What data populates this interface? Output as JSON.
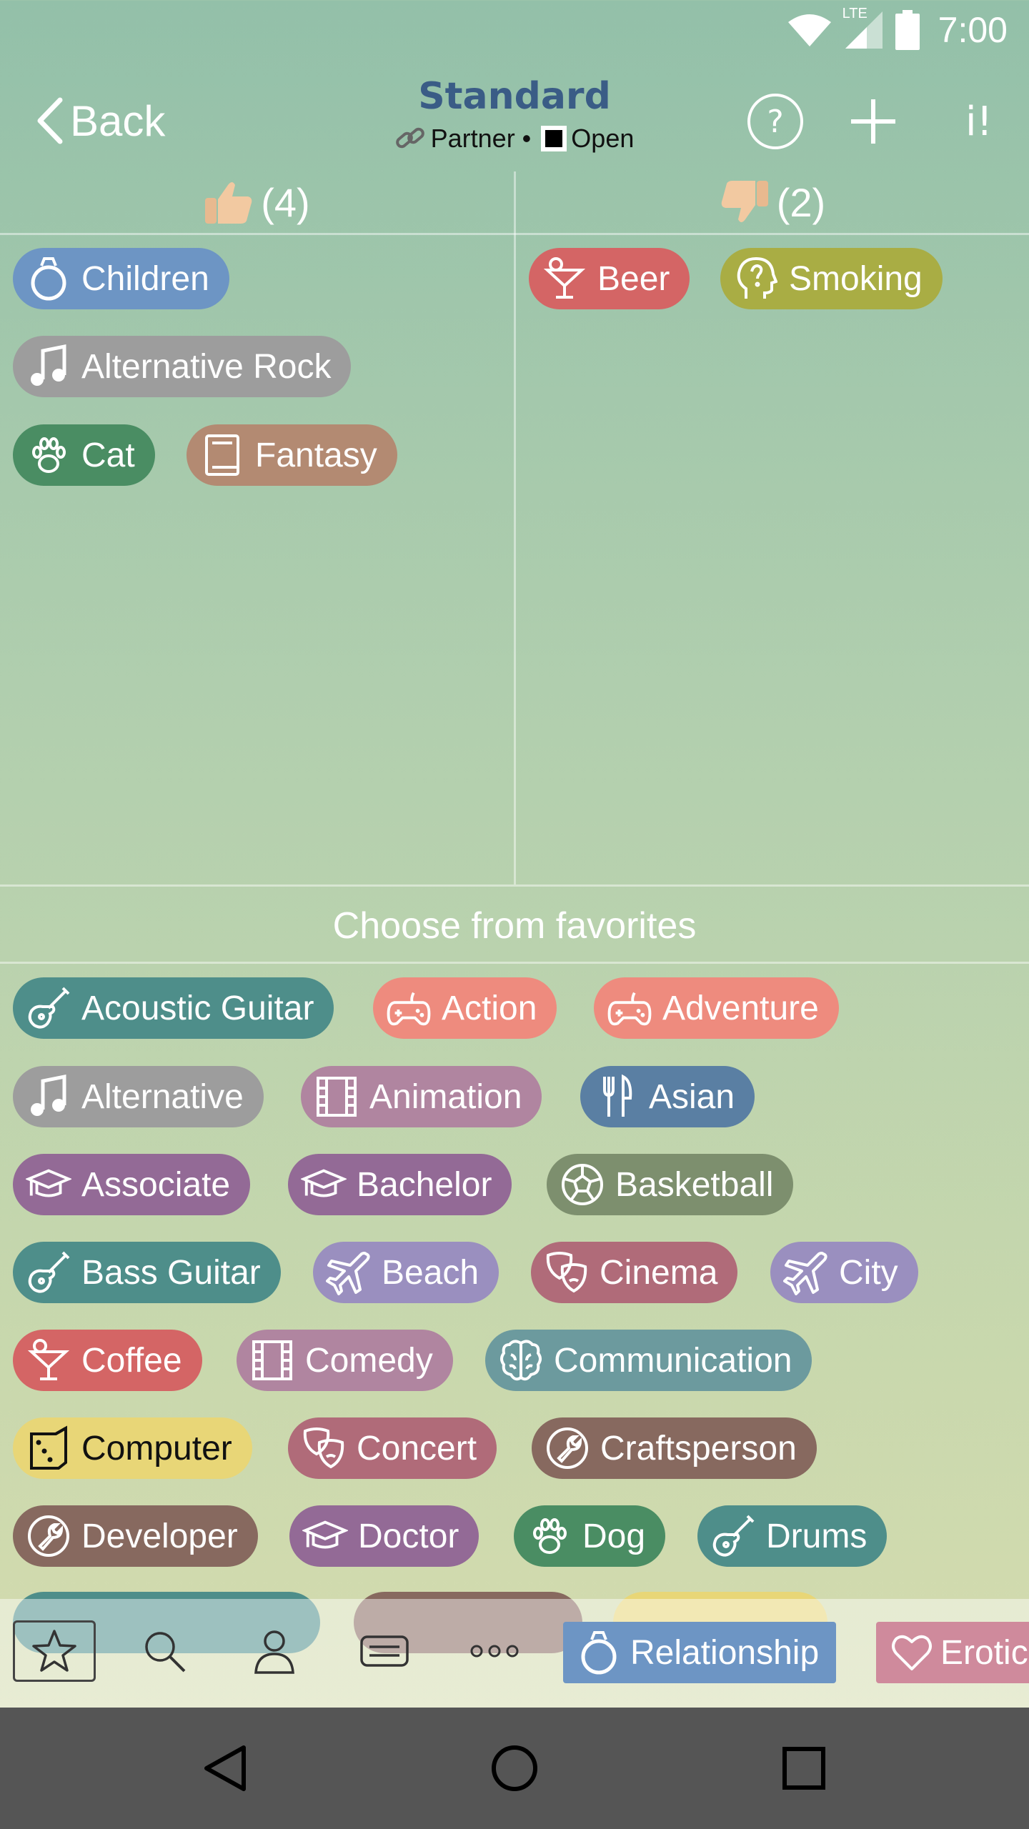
{
  "status": {
    "network": "LTE",
    "time": "7:00"
  },
  "header": {
    "back_label": "Back",
    "title": "Standard",
    "subtitle_partner": "Partner •",
    "subtitle_open": "Open",
    "info_label": "i!"
  },
  "likes": {
    "count": "(4)"
  },
  "dislikes": {
    "count": "(2)"
  },
  "liked_chips": [
    "Children",
    "Alternative Rock",
    "Cat",
    "Fantasy"
  ],
  "disliked_chips": [
    "Beer",
    "Smoking"
  ],
  "favorites": {
    "title": "Choose from favorites",
    "chips": [
      "Acoustic Guitar",
      "Action",
      "Adventure",
      "Alternative",
      "Animation",
      "Asian",
      "Associate",
      "Bachelor",
      "Basketball",
      "Bass Guitar",
      "Beach",
      "Cinema",
      "City",
      "Coffee",
      "Comedy",
      "Communication",
      "Computer",
      "Concert",
      "Craftsperson",
      "Developer",
      "Doctor",
      "Dog",
      "Drums"
    ]
  },
  "toolbar": {
    "category_1": "Relationship",
    "category_2": "Erotic"
  },
  "colors": {
    "blue": "#6d95c4",
    "gray": "#9d9d9d",
    "green": "#4a8d63",
    "brown": "#b38a72",
    "red": "#d46565",
    "olive": "#a9ad44",
    "teal": "#4e8e8a",
    "salmon": "#ee8b7e",
    "mauve": "#b085a0",
    "slate": "#5a7fa3",
    "purple": "#936a96",
    "sage": "#7d8f6e",
    "lavender": "#9a8fbf",
    "rose": "#b06b79",
    "greyteal": "#6c9a9e",
    "yellow": "#e8d677",
    "taupe": "#87695f",
    "pink": "#cf8a9c"
  }
}
